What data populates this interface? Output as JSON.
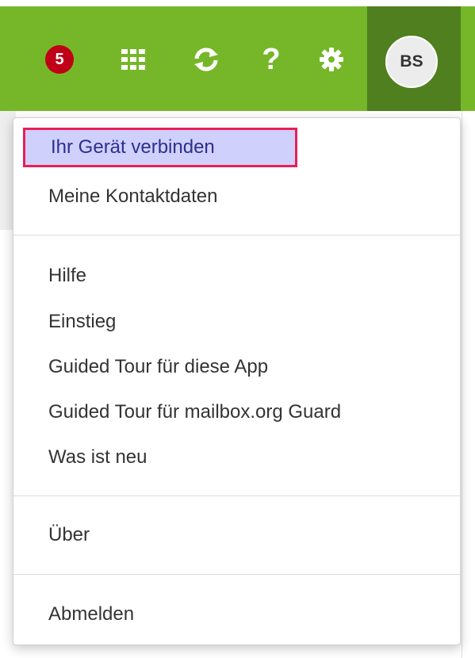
{
  "toolbar": {
    "notification_count": "5",
    "apps_icon": "grid-icon",
    "refresh_icon": "refresh-icon",
    "help_icon": "help-icon",
    "settings_icon": "gear-icon",
    "avatar_initials": "BS",
    "colors": {
      "bar": "#76b72a",
      "active_cell": "#4f7f1e",
      "badge": "#c00016"
    }
  },
  "menu": {
    "items": [
      {
        "label": "Ihr Gerät verbinden",
        "highlighted": true
      },
      {
        "label": "Meine Kontaktdaten"
      },
      {
        "label": "Hilfe"
      },
      {
        "label": "Einstieg"
      },
      {
        "label": "Guided Tour für diese App"
      },
      {
        "label": "Guided Tour für mailbox.org Guard"
      },
      {
        "label": "Was ist neu"
      },
      {
        "label": "Über"
      },
      {
        "label": "Abmelden"
      }
    ],
    "highlight_colors": {
      "fill": "#cfd0fb",
      "border": "#e81e5a"
    }
  }
}
